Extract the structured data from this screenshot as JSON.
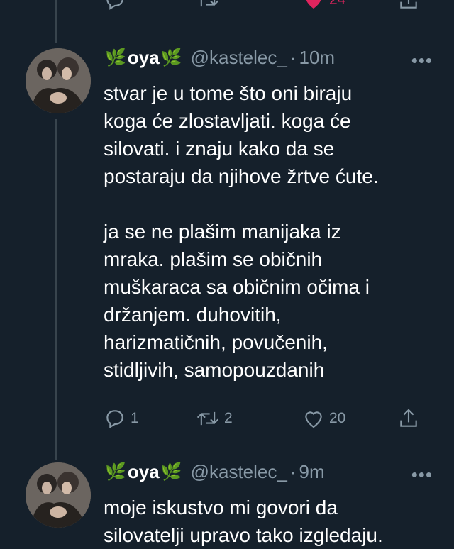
{
  "top_actions": {
    "likes": "24"
  },
  "tweets": [
    {
      "display_name": "oya",
      "emoji": "🌿",
      "handle": "@kastelec_",
      "separator": "·",
      "time": "10m",
      "more": "•••",
      "text": "stvar je u tome što oni biraju\nkoga će zlostavljati. koga će\nsilovati. i znaju kako da se\npostaraju da njihove žrtve ćute.\n\nja se ne plašim manijaka iz\nmraka. plašim se običnih\nmuškaraca sa običnim očima i\ndržanjem. duhovitih,\nharizmatičnih, povučenih,\nstidljivih, samopouzdanih",
      "replies": "1",
      "retweets": "2",
      "likes": "20"
    },
    {
      "display_name": "oya",
      "emoji": "🌿",
      "handle": "@kastelec_",
      "separator": "·",
      "time": "9m",
      "more": "•••",
      "text": "moje iskustvo mi govori da\nsilovatelji upravo tako izgledaju."
    }
  ],
  "colors": {
    "background": "#15202b",
    "secondary_text": "#8899a6",
    "like_active": "#e0245e",
    "thread_line": "#38444d"
  }
}
